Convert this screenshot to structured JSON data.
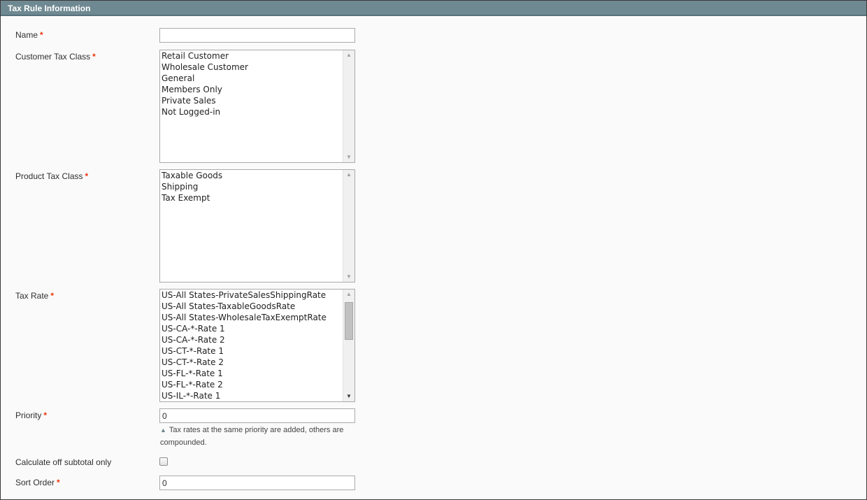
{
  "header": {
    "title": "Tax Rule Information"
  },
  "required_mark": "*",
  "fields": {
    "name": {
      "label": "Name",
      "value": ""
    },
    "customer_tax_class": {
      "label": "Customer Tax Class",
      "options": [
        "Retail Customer",
        "Wholesale Customer",
        "General",
        "Members Only",
        "Private Sales",
        "Not Logged-in"
      ]
    },
    "product_tax_class": {
      "label": "Product Tax Class",
      "options": [
        "Taxable Goods",
        "Shipping",
        "Tax Exempt"
      ]
    },
    "tax_rate": {
      "label": "Tax Rate",
      "options": [
        "US-All States-PrivateSalesShippingRate",
        "US-All States-TaxableGoodsRate",
        "US-All States-WholesaleTaxExemptRate",
        "US-CA-*-Rate 1",
        "US-CA-*-Rate 2",
        "US-CT-*-Rate 1",
        "US-CT-*-Rate 2",
        "US-FL-*-Rate 1",
        "US-FL-*-Rate 2",
        "US-IL-*-Rate 1"
      ]
    },
    "priority": {
      "label": "Priority",
      "value": "0",
      "note": "Tax rates at the same priority are added, others are compounded."
    },
    "calculate_subtotal": {
      "label": "Calculate off subtotal only",
      "checked": false
    },
    "sort_order": {
      "label": "Sort Order",
      "value": "0"
    }
  },
  "icons": {
    "note": "triangle-up-icon",
    "scroll_up": "scroll-up-arrow-icon",
    "scroll_down": "scroll-down-arrow-icon"
  }
}
